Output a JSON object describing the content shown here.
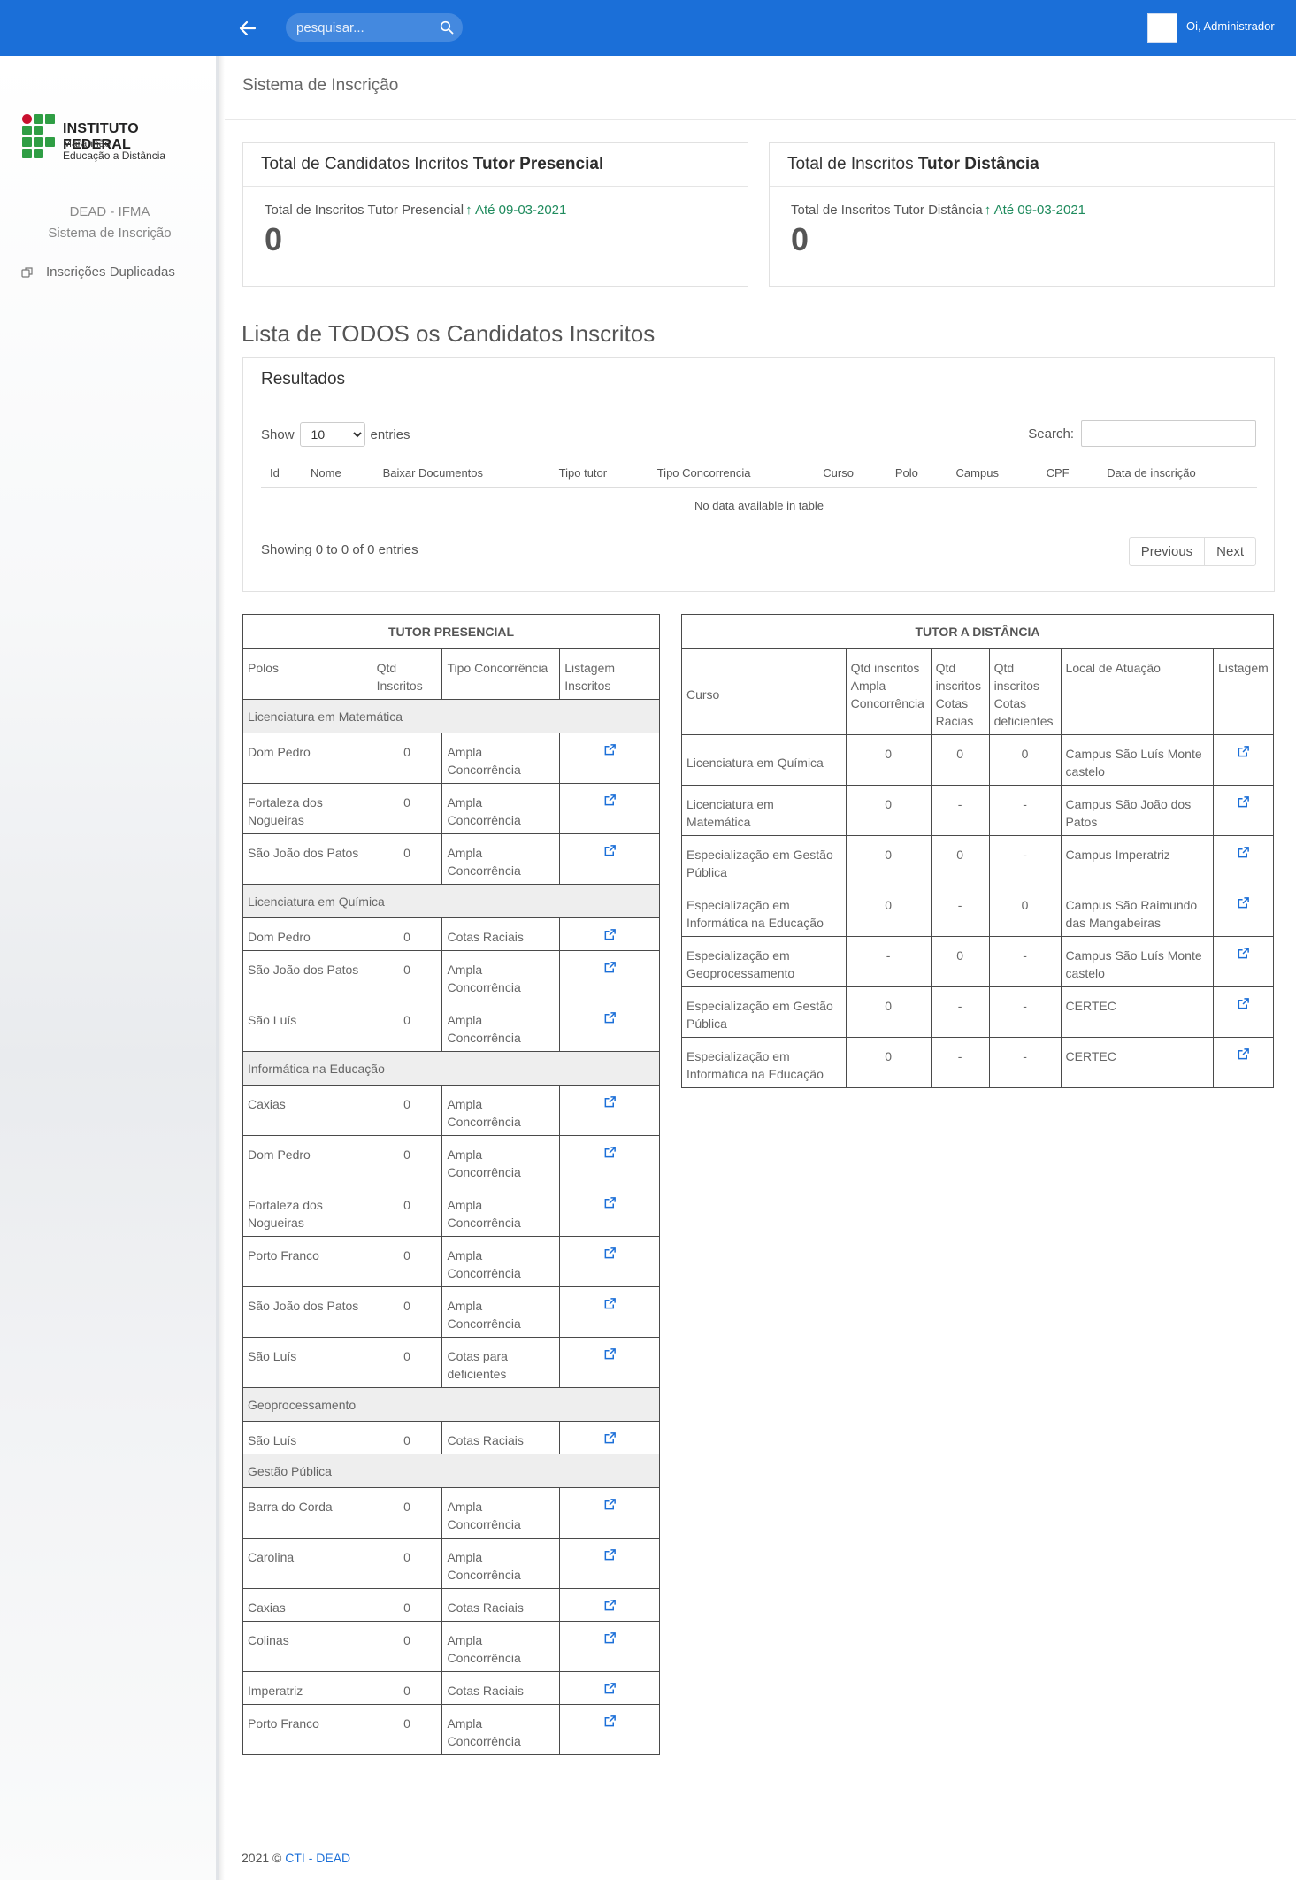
{
  "topbar": {
    "search_placeholder": "pesquisar...",
    "greeting": "Oi, Administrador",
    "color": "#1b6fd8"
  },
  "sidebar": {
    "logo": {
      "title": "INSTITUTO FEDERAL",
      "line1": "Maranhão",
      "line2": "Educação a Distância"
    },
    "org": "DEAD - IFMA",
    "system": "Sistema de Inscrição",
    "menu": [
      {
        "label": "Inscrições Duplicadas",
        "icon": "copy-icon"
      }
    ]
  },
  "header": {
    "title": "Sistema de Inscrição"
  },
  "stats": {
    "presencial": {
      "title_prefix": "Total de Candidatos Incritos ",
      "title_bold": "Tutor Presencial",
      "label": "Total de Inscritos Tutor Presencial",
      "date": "Até 09-03-2021",
      "value": "0"
    },
    "distancia": {
      "title_prefix": "Total de Inscritos ",
      "title_bold": "Tutor Distância",
      "label": "Total de Inscritos Tutor Distância",
      "date": "Até 09-03-2021",
      "value": "0"
    }
  },
  "list": {
    "heading": "Lista de TODOS os Candidatos Inscritos",
    "card_title": "Resultados",
    "show_label": "Show",
    "entries_label": "entries",
    "page_size": "10",
    "search_label": "Search:",
    "columns": [
      "Id",
      "Nome",
      "Baixar Documentos",
      "Tipo tutor",
      "Tipo Concorrencia",
      "Curso",
      "Polo",
      "Campus",
      "CPF",
      "Data de inscrição"
    ],
    "empty": "No data available in table",
    "info": "Showing 0 to 0 of 0 entries",
    "prev": "Previous",
    "next": "Next"
  },
  "presencial_table": {
    "title": "TUTOR PRESENCIAL",
    "headers": [
      "Polos",
      "Qtd Inscritos",
      "Tipo Concorrência",
      "Listagem Inscritos"
    ],
    "groups": [
      {
        "name": "Licenciatura em Matemática",
        "rows": [
          [
            "Dom Pedro",
            "0",
            "Ampla Concorrência"
          ],
          [
            "Fortaleza dos Nogueiras",
            "0",
            "Ampla Concorrência"
          ],
          [
            "São João dos Patos",
            "0",
            "Ampla Concorrência"
          ]
        ]
      },
      {
        "name": "Licenciatura em Química",
        "rows": [
          [
            "Dom Pedro",
            "0",
            "Cotas Raciais"
          ],
          [
            "São João dos Patos",
            "0",
            "Ampla Concorrência"
          ],
          [
            "São Luís",
            "0",
            "Ampla Concorrência"
          ]
        ]
      },
      {
        "name": "Informática na Educação",
        "rows": [
          [
            "Caxias",
            "0",
            "Ampla Concorrência"
          ],
          [
            "Dom Pedro",
            "0",
            "Ampla Concorrência"
          ],
          [
            "Fortaleza dos Nogueiras",
            "0",
            "Ampla Concorrência"
          ],
          [
            "Porto Franco",
            "0",
            "Ampla Concorrência"
          ],
          [
            "São João dos Patos",
            "0",
            "Ampla Concorrência"
          ],
          [
            "São Luís",
            "0",
            "Cotas para deficientes"
          ]
        ]
      },
      {
        "name": "Geoprocessamento",
        "rows": [
          [
            "São Luís",
            "0",
            "Cotas Raciais"
          ]
        ]
      },
      {
        "name": "Gestão Pública",
        "rows": [
          [
            "Barra do Corda",
            "0",
            "Ampla Concorrência"
          ],
          [
            "Carolina",
            "0",
            "Ampla Concorrência"
          ],
          [
            "Caxias",
            "0",
            "Cotas Raciais"
          ],
          [
            "Colinas",
            "0",
            "Ampla Concorrência"
          ],
          [
            "Imperatriz",
            "0",
            "Cotas Raciais"
          ],
          [
            "Porto Franco",
            "0",
            "Ampla Concorrência"
          ]
        ]
      }
    ]
  },
  "distancia_table": {
    "title": "TUTOR A DISTÂNCIA",
    "headers": [
      "Curso",
      "Qtd inscritos Ampla Concorrência",
      "Qtd inscritos Cotas Racias",
      "Qtd inscritos Cotas deficientes",
      "Local de Atuação",
      "Listagem"
    ],
    "rows": [
      [
        "Licenciatura em Química",
        "0",
        "0",
        "0",
        "Campus São Luís Monte castelo"
      ],
      [
        "Licenciatura em Matemática",
        "0",
        "-",
        "-",
        "Campus São João dos Patos"
      ],
      [
        "Especialização em Gestão Pública",
        "0",
        "0",
        "-",
        "Campus Imperatriz"
      ],
      [
        "Especialização em Informática na Educação",
        "0",
        "-",
        "0",
        "Campus São Raimundo das Mangabeiras"
      ],
      [
        "Especialização em Geoprocessamento",
        "-",
        "0",
        "-",
        "Campus São Luís Monte castelo"
      ],
      [
        "Especialização em Gestão Pública",
        "0",
        "-",
        "-",
        "CERTEC"
      ],
      [
        "Especialização em Informática na Educação",
        "0",
        "-",
        "-",
        "CERTEC"
      ]
    ]
  },
  "footer": {
    "text": "2021 © ",
    "link": "CTI - DEAD"
  }
}
